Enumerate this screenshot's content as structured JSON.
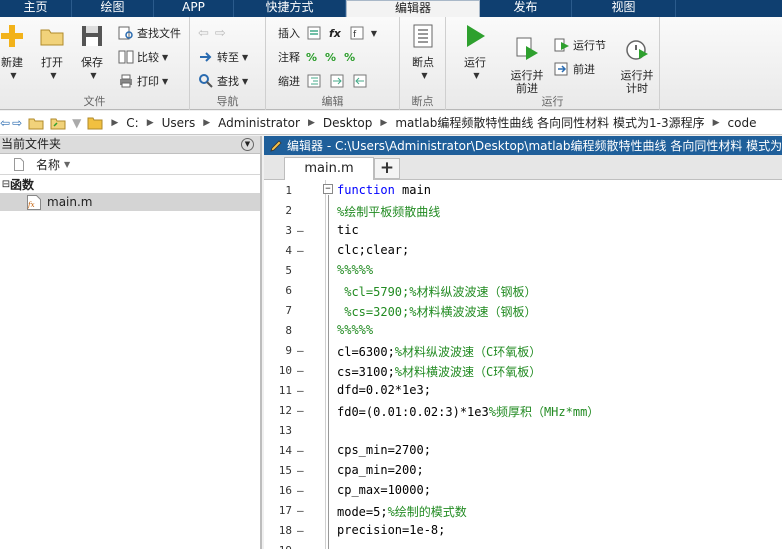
{
  "tabs": [
    "主页",
    "绘图",
    "APP",
    "快捷方式",
    "编辑器",
    "发布",
    "视图"
  ],
  "active_tab": "编辑器",
  "ribbon": {
    "file": {
      "label": "文件",
      "new": "新建",
      "open": "打开",
      "save": "保存",
      "find_files": "查找文件",
      "compare": "比较",
      "print": "打印"
    },
    "navigate": {
      "label": "导航",
      "goto": "转至",
      "find": "查找"
    },
    "edit": {
      "label": "编辑",
      "insert": "插入",
      "comment": "注释",
      "indent": "缩进",
      "fx": "fx"
    },
    "breakpoints": {
      "label": "断点",
      "breakpoints": "断点"
    },
    "run": {
      "label": "运行",
      "run": "运行",
      "run_advance": "运行并\n前进",
      "run_section": "运行节",
      "advance": "前进",
      "run_time": "运行并\n计时"
    }
  },
  "address": {
    "path": [
      "C:",
      "Users",
      "Administrator",
      "Desktop",
      "matlab编程频散特性曲线 各向同性材料 模式为1-3源程序",
      "code"
    ]
  },
  "file_panel": {
    "title": "当前文件夹",
    "column_name": "名称",
    "group": "函数",
    "files": [
      "main.m"
    ]
  },
  "editor": {
    "title": "编辑器 - C:\\Users\\Administrator\\Desktop\\matlab编程频散特性曲线 各向同性材料 模式为",
    "tab": "main.m",
    "add_tab": "+",
    "lines": [
      {
        "n": "1",
        "d": "",
        "t": [
          {
            "c": "kw",
            "s": "function"
          },
          {
            "c": "",
            "s": " main"
          }
        ]
      },
      {
        "n": "2",
        "d": "",
        "t": [
          {
            "c": "cm",
            "s": "%绘制平板频散曲线"
          }
        ]
      },
      {
        "n": "3",
        "d": "—",
        "t": [
          {
            "c": "",
            "s": "tic"
          }
        ]
      },
      {
        "n": "4",
        "d": "—",
        "t": [
          {
            "c": "",
            "s": "clc;clear;"
          }
        ]
      },
      {
        "n": "5",
        "d": "",
        "t": [
          {
            "c": "cm",
            "s": "%%%%%"
          }
        ]
      },
      {
        "n": "6",
        "d": "",
        "t": [
          {
            "c": "cm",
            "s": " %cl=5790;%材料纵波波速（钢板）"
          }
        ]
      },
      {
        "n": "7",
        "d": "",
        "t": [
          {
            "c": "cm",
            "s": " %cs=3200;%材料横波波速（钢板）"
          }
        ]
      },
      {
        "n": "8",
        "d": "",
        "t": [
          {
            "c": "cm",
            "s": "%%%%%"
          }
        ]
      },
      {
        "n": "9",
        "d": "—",
        "t": [
          {
            "c": "",
            "s": "cl=6300;"
          },
          {
            "c": "cm",
            "s": "%材料纵波波速（C环氧板）"
          }
        ]
      },
      {
        "n": "10",
        "d": "—",
        "t": [
          {
            "c": "",
            "s": "cs=3100;"
          },
          {
            "c": "cm",
            "s": "%材料横波波速（C环氧板）"
          }
        ]
      },
      {
        "n": "11",
        "d": "—",
        "t": [
          {
            "c": "",
            "s": "dfd=0.02*1e3;"
          }
        ]
      },
      {
        "n": "12",
        "d": "—",
        "t": [
          {
            "c": "",
            "s": "fd0=(0.01:0.02:3)*1e3"
          },
          {
            "c": "cm",
            "s": "%频厚积（MHz*mm）"
          }
        ]
      },
      {
        "n": "13",
        "d": "",
        "t": [
          {
            "c": "",
            "s": ""
          }
        ]
      },
      {
        "n": "14",
        "d": "—",
        "t": [
          {
            "c": "",
            "s": "cps_min=2700;"
          }
        ]
      },
      {
        "n": "15",
        "d": "—",
        "t": [
          {
            "c": "",
            "s": "cpa_min=200;"
          }
        ]
      },
      {
        "n": "16",
        "d": "—",
        "t": [
          {
            "c": "",
            "s": "cp_max=10000;"
          }
        ]
      },
      {
        "n": "17",
        "d": "—",
        "t": [
          {
            "c": "",
            "s": "mode=5;"
          },
          {
            "c": "cm",
            "s": "%绘制的模式数"
          }
        ]
      },
      {
        "n": "18",
        "d": "—",
        "t": [
          {
            "c": "",
            "s": "precision=1e-8;"
          }
        ]
      },
      {
        "n": "19",
        "d": "",
        "t": [
          {
            "c": "",
            "s": ""
          }
        ]
      }
    ]
  },
  "colors": {
    "tabbar": "#0f3f70",
    "editor_title": "#1f5f9a",
    "keyword": "#0000ff",
    "comment": "#228b22"
  }
}
